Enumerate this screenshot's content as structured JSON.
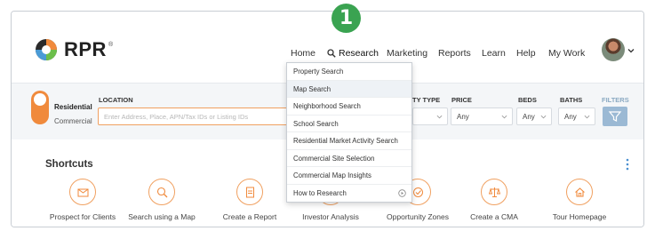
{
  "app": {
    "logo_text": "RPR",
    "logo_tm": "®",
    "brand_color": "#f08a3c",
    "badge_color": "#3aa351"
  },
  "step_badge": "1",
  "nav": {
    "items": [
      {
        "label": "Home"
      },
      {
        "label": "Research",
        "icon": "search-icon"
      },
      {
        "label": "Marketing"
      },
      {
        "label": "Reports"
      },
      {
        "label": "Learn"
      },
      {
        "label": "Help"
      },
      {
        "label": "My Work"
      }
    ]
  },
  "search": {
    "residential_label": "Residential",
    "commercial_label": "Commercial",
    "location_label": "LOCATION",
    "location_placeholder": "Enter Address, Place, APN/Tax IDs or Listing IDs",
    "property_type_label": "TY TYPE",
    "price_label": "PRICE",
    "beds_label": "BEDS",
    "baths_label": "BATHS",
    "filters_label": "FILTERS",
    "price_value": "Any",
    "beds_value": "Any",
    "baths_value": "Any"
  },
  "dropdown": {
    "items": [
      {
        "label": "Property Search"
      },
      {
        "label": "Map Search"
      },
      {
        "label": "Neighborhood Search"
      },
      {
        "label": "School Search"
      },
      {
        "label": "Residential Market Activity Search"
      },
      {
        "label": "Commercial Site Selection"
      },
      {
        "label": "Commercial Map Insights"
      },
      {
        "label": "How to Research",
        "icon": "play-circle-icon"
      }
    ]
  },
  "shortcuts": {
    "title": "Shortcuts",
    "items": [
      {
        "label": "Prospect for Clients",
        "icon": "prospect-icon"
      },
      {
        "label": "Search using a Map",
        "icon": "map-search-icon"
      },
      {
        "label": "Create a Report",
        "icon": "report-icon"
      },
      {
        "label": "Investor Analysis",
        "icon": "investor-icon"
      },
      {
        "label": "Opportunity Zones",
        "icon": "opportunity-zone-icon"
      },
      {
        "label": "Create a CMA",
        "icon": "cma-scale-icon"
      },
      {
        "label": "Tour Homepage",
        "icon": "home-icon"
      }
    ]
  }
}
